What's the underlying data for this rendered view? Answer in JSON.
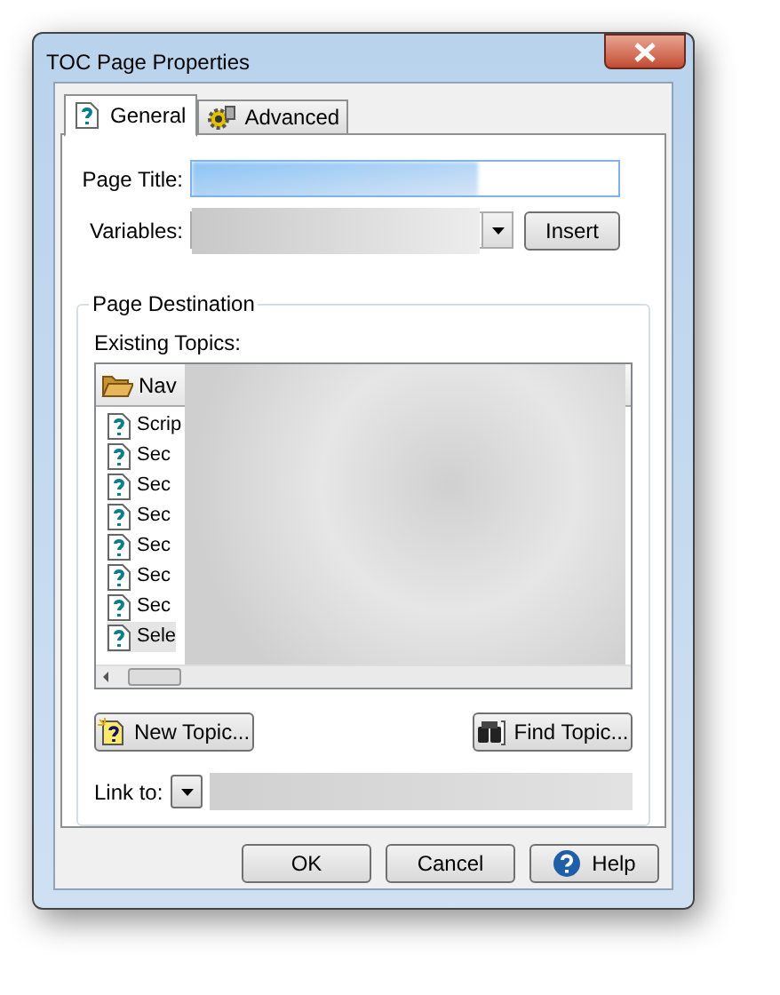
{
  "window": {
    "title": "TOC Page Properties"
  },
  "tabs": [
    {
      "label": "General",
      "selected": true,
      "kind": "help"
    },
    {
      "label": "Advanced",
      "selected": false,
      "kind": "gear"
    }
  ],
  "page_title": {
    "label": "Page Title:"
  },
  "variables": {
    "label": "Variables:",
    "button": "Insert"
  },
  "page_destination": {
    "title": "Page Destination",
    "existing_topics_label": "Existing Topics:",
    "header": "Nav",
    "topics": [
      {
        "label": "Scrip",
        "selected": false
      },
      {
        "label": "Sec",
        "selected": false
      },
      {
        "label": "Sec",
        "selected": false
      },
      {
        "label": "Sec",
        "selected": false
      },
      {
        "label": "Sec",
        "selected": false
      },
      {
        "label": "Sec",
        "selected": false
      },
      {
        "label": "Sec",
        "selected": false
      },
      {
        "label": "Sele",
        "selected": true
      }
    ]
  },
  "topic_buttons": [
    {
      "label": "New Topic...",
      "kind": "new"
    },
    {
      "label": "Find Topic...",
      "kind": "find"
    }
  ],
  "link_to": {
    "label": "Link to:"
  },
  "buttons": [
    {
      "label": "OK",
      "kind": "default"
    },
    {
      "label": "Cancel",
      "kind": "plain"
    },
    {
      "label": "Help",
      "kind": "help"
    }
  ]
}
